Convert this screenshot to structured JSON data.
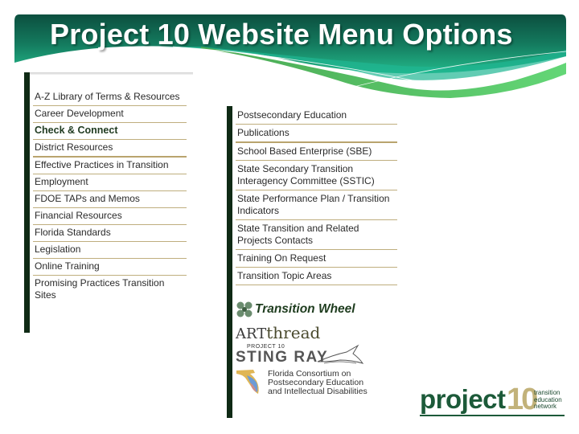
{
  "slide": {
    "title": "Project 10 Website Menu Options",
    "colors": {
      "banner_dark": "#0e5e4c",
      "banner_light": "#5ccf78",
      "sidebar_bar": "#0f2a15",
      "divider": "#bfae7e"
    }
  },
  "menu_left": {
    "items": [
      {
        "label": "A-Z Library of Terms & Resources"
      },
      {
        "label": "Career Development"
      },
      {
        "label": "Check & Connect"
      },
      {
        "label": "District Resources"
      },
      {
        "label": "Effective Practices in Transition"
      },
      {
        "label": "Employment"
      },
      {
        "label": "FDOE TAPs and Memos"
      },
      {
        "label": "Financial Resources"
      },
      {
        "label": "Florida Standards"
      },
      {
        "label": "Legislation"
      },
      {
        "label": "Online Training"
      },
      {
        "label": "Promising Practices Transition Sites"
      }
    ]
  },
  "menu_right": {
    "items": [
      {
        "label": "Postsecondary Education"
      },
      {
        "label": "Publications"
      },
      {
        "label": "School Based Enterprise (SBE)"
      },
      {
        "label": "State Secondary Transition Interagency Committee (SSTIC)"
      },
      {
        "label": "State Performance Plan / Transition Indicators"
      },
      {
        "label": "State Transition and Related Projects Contacts"
      },
      {
        "label": "Training On Request"
      },
      {
        "label": "Transition Topic Areas"
      }
    ],
    "logos": {
      "transition_wheel": "Transition Wheel",
      "artthread_art": "ART",
      "artthread_thread": "thread",
      "stingray_small": "PROJECT 10",
      "stingray_big": "STING RAY",
      "consortium_line1": "Florida Consortium on",
      "consortium_line2": "Postsecondary Education",
      "consortium_line3": "and Intellectual Disabilities"
    }
  },
  "footer_logo": {
    "word": "project",
    "number": "10",
    "tag_line1": "transition",
    "tag_line2": "education",
    "tag_line3": "network"
  }
}
